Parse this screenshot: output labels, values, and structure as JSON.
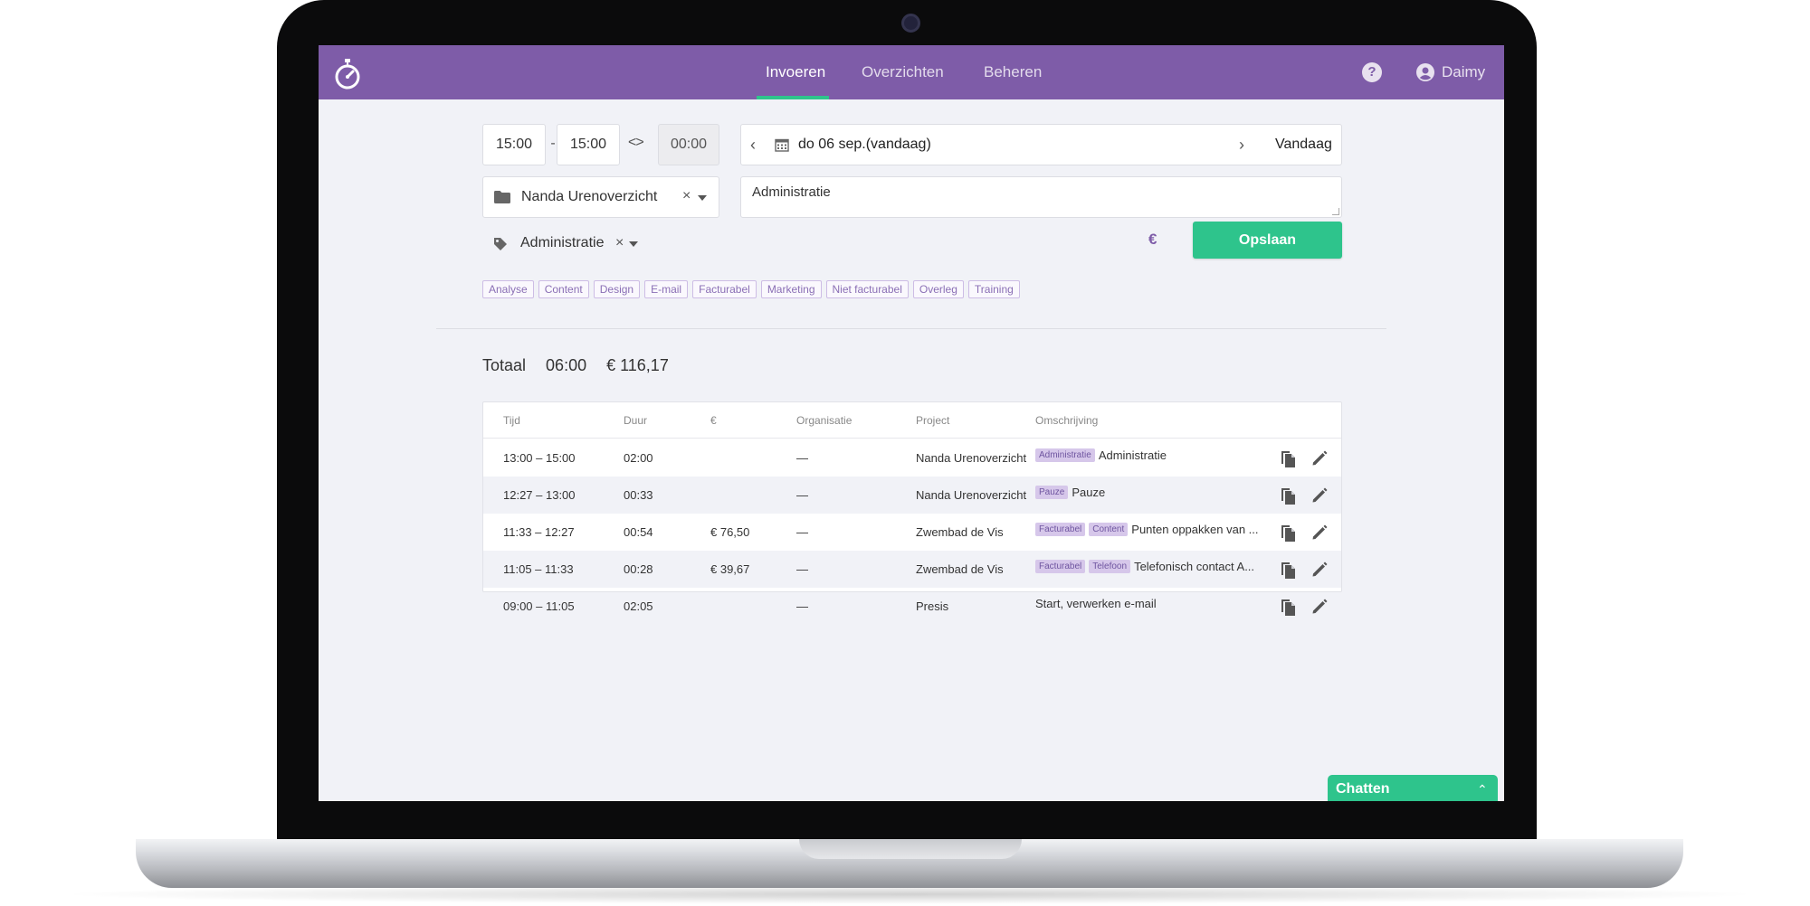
{
  "app": {
    "nav": {
      "tabs": [
        "Invoeren",
        "Overzichten",
        "Beheren"
      ],
      "active": "Invoeren"
    },
    "user": {
      "name": "Daimy"
    },
    "colors": {
      "brand": "#7e5ca8",
      "accent": "#2ec48c"
    }
  },
  "entry": {
    "start": "15:00",
    "end": "15:00",
    "separator": "-",
    "swap": "<>",
    "duration": "00:00",
    "date": "do 06 sep.(vandaag)",
    "today_label": "Vandaag",
    "project": "Nanda Urenoverzicht",
    "description": "Administratie",
    "tag": "Administratie",
    "clear": "×",
    "euro": "€",
    "save_label": "Opslaan",
    "chips": [
      "Analyse",
      "Content",
      "Design",
      "E-mail",
      "Facturabel",
      "Marketing",
      "Niet facturabel",
      "Overleg",
      "Training"
    ]
  },
  "totals": {
    "label": "Totaal",
    "duration": "06:00",
    "amount": "€ 116,17"
  },
  "table": {
    "headers": [
      "Tijd",
      "Duur",
      "€",
      "Organisatie",
      "Project",
      "Omschrijving"
    ],
    "rows": [
      {
        "time": "13:00 – 15:00",
        "dur": "02:00",
        "euro": "",
        "org": "—",
        "project": "Nanda Urenoverzicht",
        "tags": [
          "Administratie"
        ],
        "desc": "Administratie"
      },
      {
        "time": "12:27 – 13:00",
        "dur": "00:33",
        "euro": "",
        "org": "—",
        "project": "Nanda Urenoverzicht",
        "tags": [
          "Pauze"
        ],
        "desc": "Pauze"
      },
      {
        "time": "11:33 – 12:27",
        "dur": "00:54",
        "euro": "€ 76,50",
        "org": "—",
        "project": "Zwembad de Vis",
        "tags": [
          "Facturabel",
          "Content"
        ],
        "desc": "Punten oppakken van ..."
      },
      {
        "time": "11:05 – 11:33",
        "dur": "00:28",
        "euro": "€ 39,67",
        "org": "—",
        "project": "Zwembad de Vis",
        "tags": [
          "Facturabel",
          "Telefoon"
        ],
        "desc": "Telefonisch contact A..."
      },
      {
        "time": "09:00 – 11:05",
        "dur": "02:05",
        "euro": "",
        "org": "—",
        "project": "Presis",
        "tags": [],
        "desc": "Start, verwerken e-mail"
      }
    ]
  },
  "chat": {
    "label": "Chatten"
  }
}
